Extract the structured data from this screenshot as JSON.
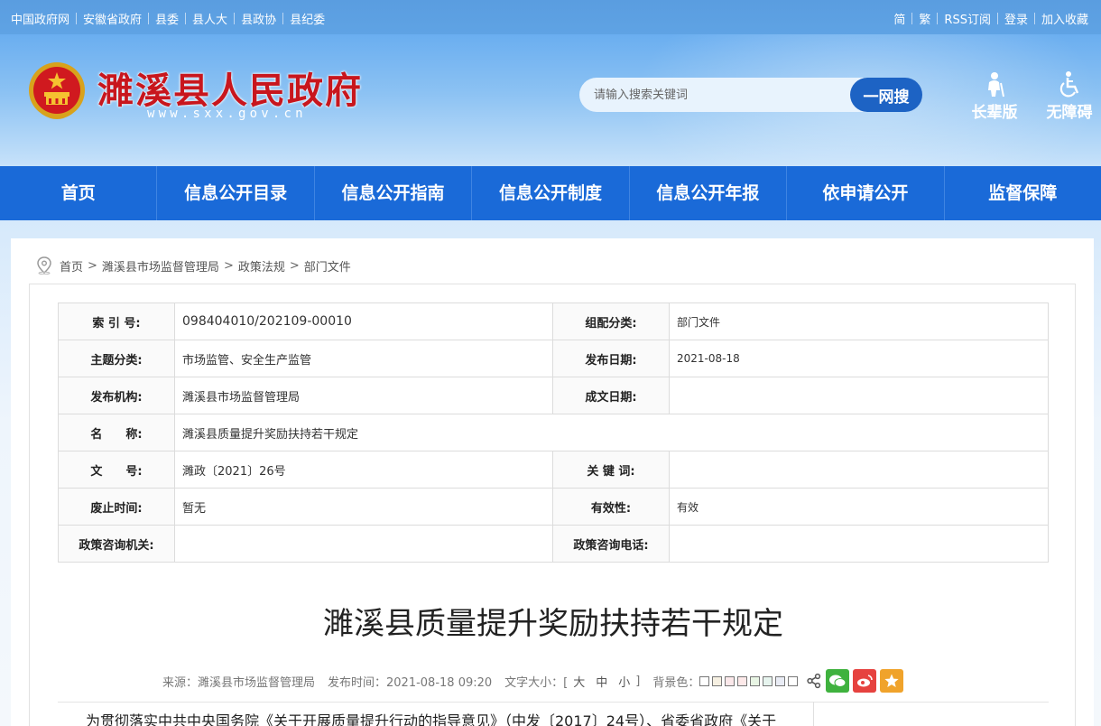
{
  "topbar": {
    "links": [
      "中国政府网",
      "安徽省政府",
      "县委",
      "县人大",
      "县政协",
      "县纪委"
    ],
    "right_links": [
      "简",
      "繁",
      "RSS订阅",
      "登录",
      "加入收藏"
    ]
  },
  "header": {
    "title": "濉溪县人民政府",
    "url": "www.sxx.gov.cn",
    "search_placeholder": "请输入搜索关键词",
    "search_button": "一网搜",
    "elder_label": "长辈版",
    "accessible_label": "无障碍"
  },
  "nav": [
    "首页",
    "信息公开目录",
    "信息公开指南",
    "信息公开制度",
    "信息公开年报",
    "依申请公开",
    "监督保障"
  ],
  "breadcrumb": [
    "首页",
    "濉溪县市场监督管理局",
    "政策法规",
    "部门文件"
  ],
  "meta": {
    "index_no_label": "索 引 号:",
    "index_no": "098404010/202109-00010",
    "category_label": "组配分类:",
    "category": "部门文件",
    "topic_label": "主题分类:",
    "topic": "市场监管、安全生产监管",
    "pub_date_label": "发布日期:",
    "pub_date": "2021-08-18",
    "issuer_label": "发布机构:",
    "issuer": "濉溪县市场监督管理局",
    "written_date_label": "成文日期:",
    "written_date": "",
    "name_label": "名　　称:",
    "name": "濉溪县质量提升奖励扶持若干规定",
    "doc_no_label": "文　　号:",
    "doc_no": "濉政〔2021〕26号",
    "keywords_label": "关 键 词:",
    "keywords": "",
    "expiry_label": "废止时间:",
    "expiry": "暂无",
    "validity_label": "有效性:",
    "validity": "有效",
    "consult_org_label": "政策咨询机关:",
    "consult_org": "",
    "consult_phone_label": "政策咨询电话:",
    "consult_phone": ""
  },
  "article": {
    "title": "濉溪县质量提升奖励扶持若干规定",
    "source": "来源：濉溪县市场监督管理局",
    "published": "发布时间：2021-08-18 09:20",
    "font_size_label": "文字大小：[",
    "font_big": "大",
    "font_mid": "中",
    "font_small": "小",
    "font_close": "]",
    "bg_label": "背景色：",
    "first_line": "为贯彻落实中共中央国务院《关于开展质量提升行动的指导意见》（中发〔2017〕24号）、省委省政府《关于"
  },
  "colors": {
    "nav_bg": "#1a6ad8",
    "title_red": "#c8161d",
    "search_btn": "#1d63c4",
    "swatches": [
      "#ffffff",
      "#f6f0e2",
      "#fbe8ea",
      "#fde9e9",
      "#e8f5e4",
      "#e6f4ee",
      "#e9ecf5",
      "#ffffff"
    ]
  }
}
